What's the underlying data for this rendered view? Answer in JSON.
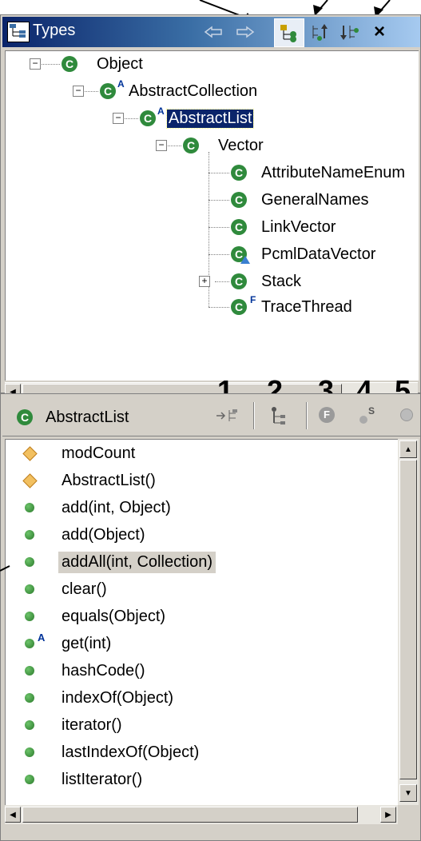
{
  "types_view": {
    "title": "Types",
    "toolbar": {
      "back_icon": "back-arrow-icon",
      "forward_icon": "forward-arrow-icon",
      "type_hierarchy_icon": "type-hierarchy-icon",
      "supertype_icon": "supertype-hierarchy-icon",
      "subtype_icon": "subtype-hierarchy-icon",
      "close_label": "×"
    },
    "tree": [
      {
        "label": "Object"
      },
      {
        "label": "AbstractCollection",
        "modifier": "A"
      },
      {
        "label": "AbstractList",
        "modifier": "A"
      },
      {
        "label": "Vector"
      },
      {
        "label": "AttributeNameEnum"
      },
      {
        "label": "GeneralNames"
      },
      {
        "label": "LinkVector"
      },
      {
        "label": "PcmlDataVector"
      },
      {
        "label": "Stack"
      },
      {
        "label": "TraceThread",
        "modifier": "F"
      }
    ],
    "class_badge": "C",
    "expand_symbol": "+",
    "collapse_symbol": "−"
  },
  "numbers": [
    "1",
    "2",
    "3",
    "4",
    "5"
  ],
  "members_view": {
    "title": "AbstractList",
    "class_badge": "C",
    "toolbar": {
      "show_inherited_icon": "show-inherited-members-icon",
      "lock_view_icon": "lock-view-icon",
      "hide_fields_icon": "hide-fields-icon",
      "hide_static_icon": "hide-static-members-icon",
      "hide_nonpublic_icon": "hide-nonpublic-members-icon",
      "static_label": "S"
    },
    "members": [
      {
        "label": "modCount",
        "icon": "protected-field-icon"
      },
      {
        "label": "AbstractList()",
        "icon": "protected-constructor-icon"
      },
      {
        "label": "add(int, Object)",
        "icon": "public-method-icon"
      },
      {
        "label": "add(Object)",
        "icon": "public-method-icon"
      },
      {
        "label": "addAll(int, Collection)",
        "icon": "public-method-icon"
      },
      {
        "label": "clear()",
        "icon": "public-method-icon"
      },
      {
        "label": "equals(Object)",
        "icon": "public-method-icon"
      },
      {
        "label": "get(int)",
        "icon": "public-method-icon",
        "modifier": "A"
      },
      {
        "label": "hashCode()",
        "icon": "public-method-icon"
      },
      {
        "label": "indexOf(Object)",
        "icon": "public-method-icon"
      },
      {
        "label": "iterator()",
        "icon": "public-method-icon"
      },
      {
        "label": "lastIndexOf(Object)",
        "icon": "public-method-icon"
      },
      {
        "label": "listIterator()",
        "icon": "public-method-icon"
      }
    ]
  },
  "colors": {
    "title_gradient_start": "#0a246a",
    "title_gradient_end": "#a6caf0",
    "class_badge_green": "#2f8a3c",
    "selection_blue": "#0a246a",
    "chrome_gray": "#d4d0c8"
  }
}
